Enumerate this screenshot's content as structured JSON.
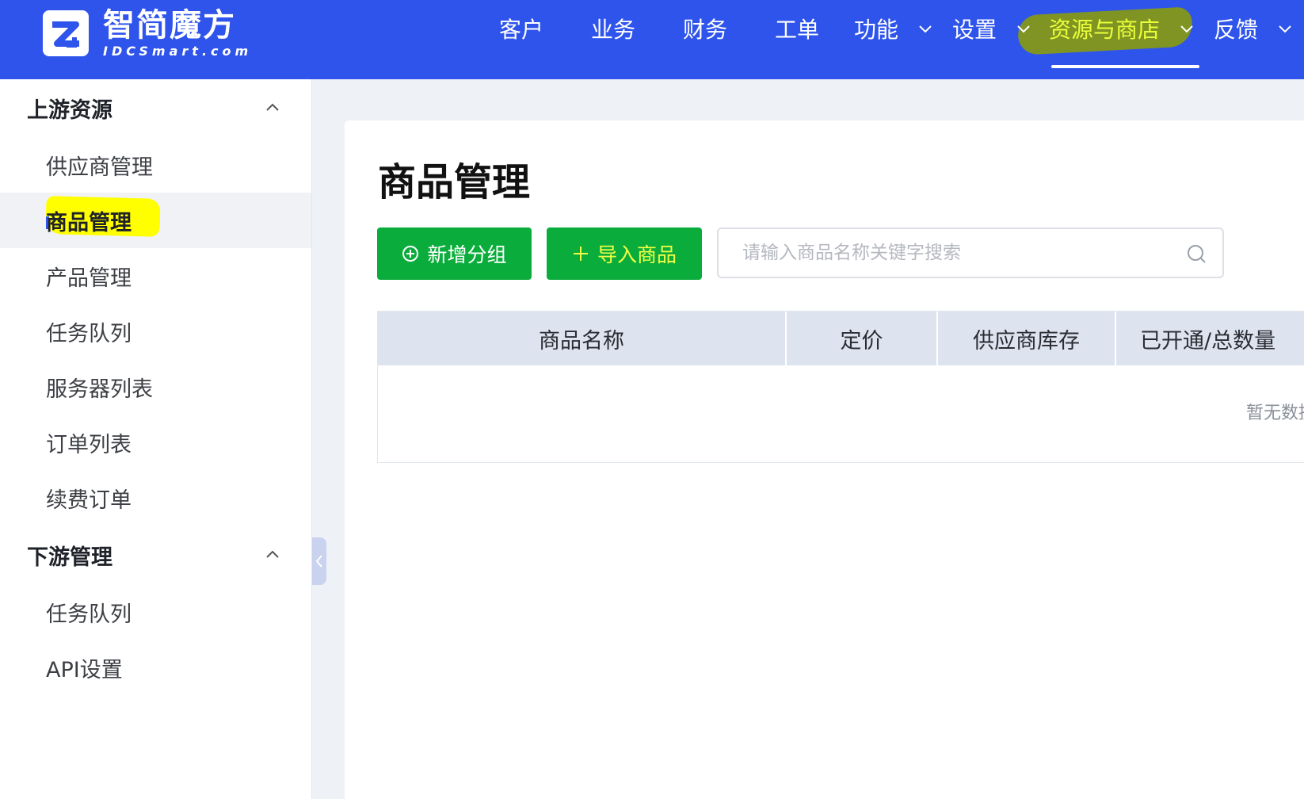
{
  "header": {
    "logo": {
      "cn": "智简魔方",
      "en": "IDCSmart.com"
    },
    "nav": [
      {
        "label": "客户"
      },
      {
        "label": "业务"
      },
      {
        "label": "财务"
      },
      {
        "label": "工单"
      },
      {
        "label": "功能"
      },
      {
        "label": "设置"
      },
      {
        "label": "资源与商店"
      },
      {
        "label": "反馈"
      }
    ],
    "active_nav": "资源与商店"
  },
  "sidebar": {
    "groups": [
      {
        "title": "上游资源",
        "items": [
          "供应商管理",
          "商品管理",
          "产品管理",
          "任务队列",
          "服务器列表",
          "订单列表",
          "续费订单"
        ]
      },
      {
        "title": "下游管理",
        "items": [
          "任务队列",
          "API设置"
        ]
      }
    ],
    "active_item": "商品管理"
  },
  "main": {
    "title": "商品管理",
    "buttons": {
      "new_group": "新增分组",
      "import_goods": "导入商品"
    },
    "search": {
      "placeholder": "请输入商品名称关键字搜索",
      "value": ""
    },
    "table": {
      "columns": [
        "商品名称",
        "定价",
        "供应商库存",
        "已开通/总数量"
      ],
      "empty_text": "暂无数据"
    }
  },
  "colors": {
    "topbar": "#2f54eb",
    "primary_button": "#0aad3b",
    "table_header": "#dde3ef",
    "highlight": "#ffff00"
  }
}
